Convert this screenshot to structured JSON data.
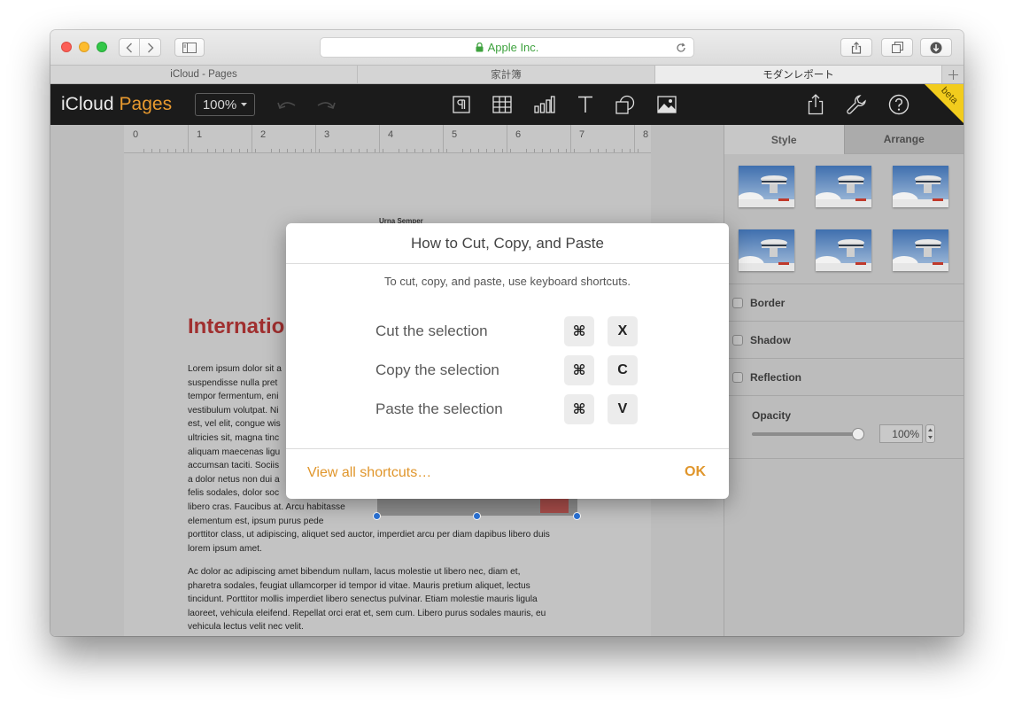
{
  "browser": {
    "address": "Apple Inc.",
    "tabs": [
      {
        "label": "iCloud - Pages",
        "active": false
      },
      {
        "label": "家計簿",
        "active": false
      },
      {
        "label": "モダンレポート",
        "active": true
      }
    ]
  },
  "toolbar": {
    "logo_word": "iCloud",
    "logo_app": "Pages",
    "zoom": "100%",
    "beta": "beta",
    "accent_color": "#e99a2f"
  },
  "document": {
    "ruler_numbers": [
      "0",
      "1",
      "2",
      "3",
      "4",
      "5",
      "6",
      "7",
      "8"
    ],
    "author": "Urna Semper",
    "title": "Internation",
    "paragraph1_left": [
      "Lorem ipsum dolor sit a",
      "suspendisse nulla pret",
      "tempor fermentum, eni",
      "vestibulum volutpat. Ni",
      "est, vel elit, congue wis",
      "ultricies sit, magna tinc",
      "aliquam maecenas ligu",
      "accumsan taciti. Sociis",
      "a dolor netus non dui a",
      "felis sodales, dolor soc",
      "libero cras. Faucibus at. Arcu habitasse",
      "elementum est, ipsum purus pede"
    ],
    "paragraph1_tail": [
      "porttitor class, ut adipiscing, aliquet sed auctor, imperdiet arcu per diam dapibus libero duis",
      "lorem ipsum amet."
    ],
    "paragraph2": [
      "Ac dolor ac adipiscing amet bibendum nullam, lacus molestie ut libero nec, diam et,",
      "pharetra sodales, feugiat ullamcorper id tempor id vitae. Mauris pretium aliquet, lectus",
      "tincidunt. Porttitor mollis imperdiet libero senectus pulvinar. Etiam molestie mauris ligula",
      "laoreet, vehicula eleifend. Repellat orci erat et, sem cum. Libero purus sodales mauris, eu",
      "vehicula lectus velit nec velit."
    ]
  },
  "inspector": {
    "tabs": [
      "Style",
      "Arrange"
    ],
    "options": [
      "Border",
      "Shadow",
      "Reflection"
    ],
    "opacity_label": "Opacity",
    "opacity_value": "100%",
    "opacity_level": 1.0
  },
  "dialog": {
    "title": "How to Cut, Copy, and Paste",
    "subtitle": "To cut, copy, and paste, use keyboard shortcuts.",
    "shortcuts": [
      {
        "label": "Cut the selection",
        "modifier": "⌘",
        "key": "X"
      },
      {
        "label": "Copy the selection",
        "modifier": "⌘",
        "key": "C"
      },
      {
        "label": "Paste the selection",
        "modifier": "⌘",
        "key": "V"
      }
    ],
    "link": "View all shortcuts…",
    "ok": "OK",
    "accent_color": "#e0962c"
  }
}
